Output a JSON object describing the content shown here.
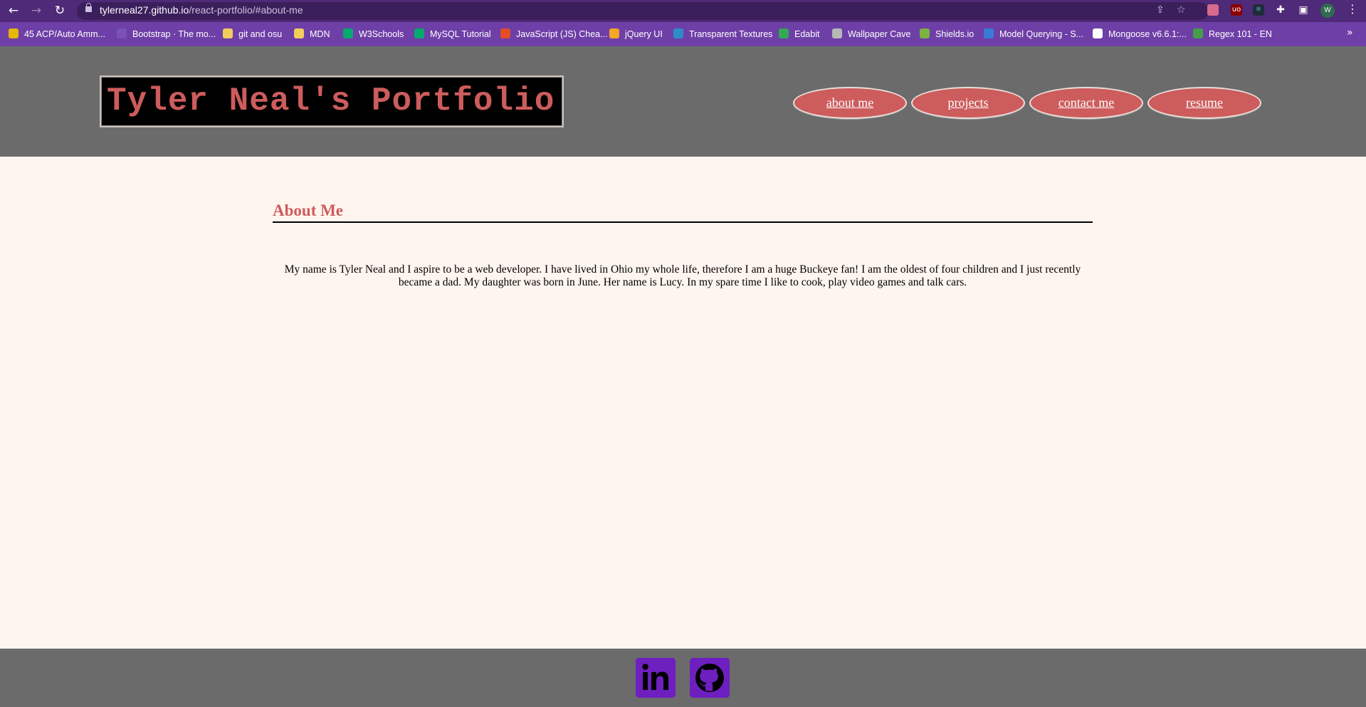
{
  "browser": {
    "url_host": "tylerneal27.github.io",
    "url_path": "/react-portfolio/#about-me",
    "profile_initial": "W",
    "icons": [
      "back-icon",
      "forward-icon",
      "reload-icon",
      "lock-icon",
      "share-icon",
      "star-icon",
      "extensions-icon",
      "sidebar-icon",
      "more-icon"
    ]
  },
  "bookmarks": [
    {
      "label": "45 ACP/Auto Amm...",
      "color": "#e6b800"
    },
    {
      "label": "Bootstrap · The mo...",
      "color": "#7952b3"
    },
    {
      "label": "git and osu",
      "color": "#f2cd5c"
    },
    {
      "label": "MDN",
      "color": "#f2cd5c"
    },
    {
      "label": "W3Schools",
      "color": "#04aa6d"
    },
    {
      "label": "MySQL Tutorial",
      "color": "#04aa6d"
    },
    {
      "label": "JavaScript (JS) Chea...",
      "color": "#e44d26"
    },
    {
      "label": "jQuery UI",
      "color": "#f5a623"
    },
    {
      "label": "Transparent Textures",
      "color": "#2d8dc8"
    },
    {
      "label": "Edabit",
      "color": "#34a853"
    },
    {
      "label": "Wallpaper Cave",
      "color": "#b8b8b8"
    },
    {
      "label": "Shields.io",
      "color": "#7cb342"
    },
    {
      "label": "Model Querying - S...",
      "color": "#3a7bd5"
    },
    {
      "label": "Mongoose v6.6.1:...",
      "color": "#ffffff"
    },
    {
      "label": "Regex 101 - EN",
      "color": "#43a047"
    }
  ],
  "header": {
    "logo": "Tyler Neal's Portfolio",
    "nav": [
      "about me",
      "projects",
      "contact me",
      "resume"
    ]
  },
  "about": {
    "heading": "About Me",
    "text": "My name is Tyler Neal and I aspire to be a web developer. I have lived in Ohio my whole life, therefore I am a huge Buckeye fan! I am the oldest of four children and I just recently became a dad. My daughter was born in June. Her name is Lucy. In my spare time I like to cook, play video games and talk cars."
  },
  "footer": {
    "icons": [
      "linkedin-icon",
      "github-icon"
    ]
  },
  "colors": {
    "accent": "#cd5c5c",
    "header_bg": "#6b6b6b",
    "page_bg": "#fff5ef",
    "social_bg": "#6d1fbf"
  }
}
